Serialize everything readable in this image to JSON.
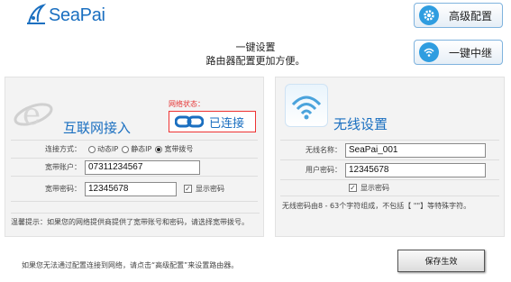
{
  "brand": {
    "name": "SeaPai"
  },
  "top_buttons": {
    "advanced": {
      "label": "高级配置",
      "icon": "gear-icon"
    },
    "relay": {
      "label": "一键中继",
      "icon": "wifi-icon"
    }
  },
  "header": {
    "line1": "一键设置",
    "line2": "路由器配置更加方便。"
  },
  "internet": {
    "title": "互联网接入",
    "status_label": "网络状态：",
    "status_text": "已连接",
    "connection_type_label": "连接方式：",
    "connection_options": [
      "动态IP",
      "静态IP",
      "宽带拨号"
    ],
    "selected_option": "宽带拨号",
    "account_label": "宽带账户：",
    "account_value": "07311234567",
    "password_label": "宽带密码：",
    "password_value": "12345678",
    "show_password_label": "显示密码",
    "show_password_checked": true,
    "tip": "温馨提示：如果您的网络提供商提供了宽带账号和密码，请选择宽带拨号。"
  },
  "wireless": {
    "title": "无线设置",
    "ssid_label": "无线名称：",
    "ssid_value": "SeaPai_001",
    "password_label": "用户密码：",
    "password_value": "12345678",
    "show_password_label": "显示密码",
    "show_password_checked": true,
    "rule": "无线密码由8 - 63个字符组成，不包括【 \"\"】等特殊字符。"
  },
  "footer": {
    "note": "如果您无法通过配置连接到网络，请点击“高级配置”来设置路由器。",
    "save_label": "保存生效"
  },
  "colors": {
    "accent": "#1a6fc0",
    "status_red": "#e53333",
    "button_blue": "#2f9de0"
  }
}
